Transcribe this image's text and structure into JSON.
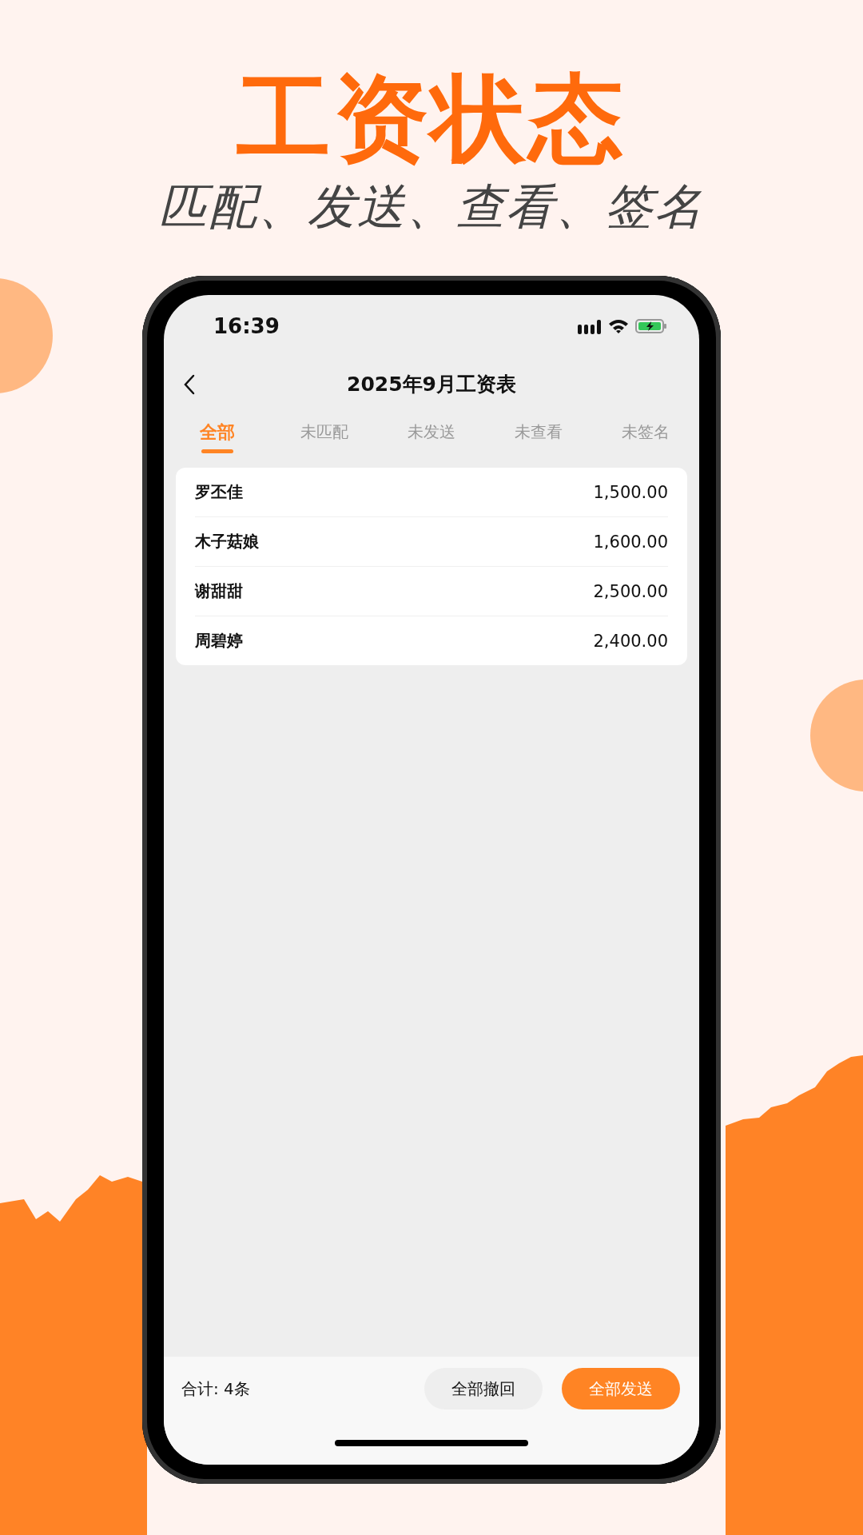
{
  "headline": "工资状态",
  "subtitle": "匹配、发送、查看、签名",
  "status_bar": {
    "time": "16:39"
  },
  "nav": {
    "title": "2025年9月工资表"
  },
  "tabs": [
    {
      "label": "全部",
      "selected": true
    },
    {
      "label": "未匹配",
      "selected": false
    },
    {
      "label": "未发送",
      "selected": false
    },
    {
      "label": "未查看",
      "selected": false
    },
    {
      "label": "未签名",
      "selected": false
    }
  ],
  "rows": [
    {
      "name": "罗丕佳",
      "amount": "1,500.00"
    },
    {
      "name": "木子菇娘",
      "amount": "1,600.00"
    },
    {
      "name": "谢甜甜",
      "amount": "2,500.00"
    },
    {
      "name": "周碧婷",
      "amount": "2,400.00"
    }
  ],
  "footer": {
    "total": "合计: 4条",
    "buttons": [
      {
        "label": "全部撤回",
        "kind": "secondary"
      },
      {
        "label": "全部发送",
        "kind": "primary"
      }
    ]
  }
}
